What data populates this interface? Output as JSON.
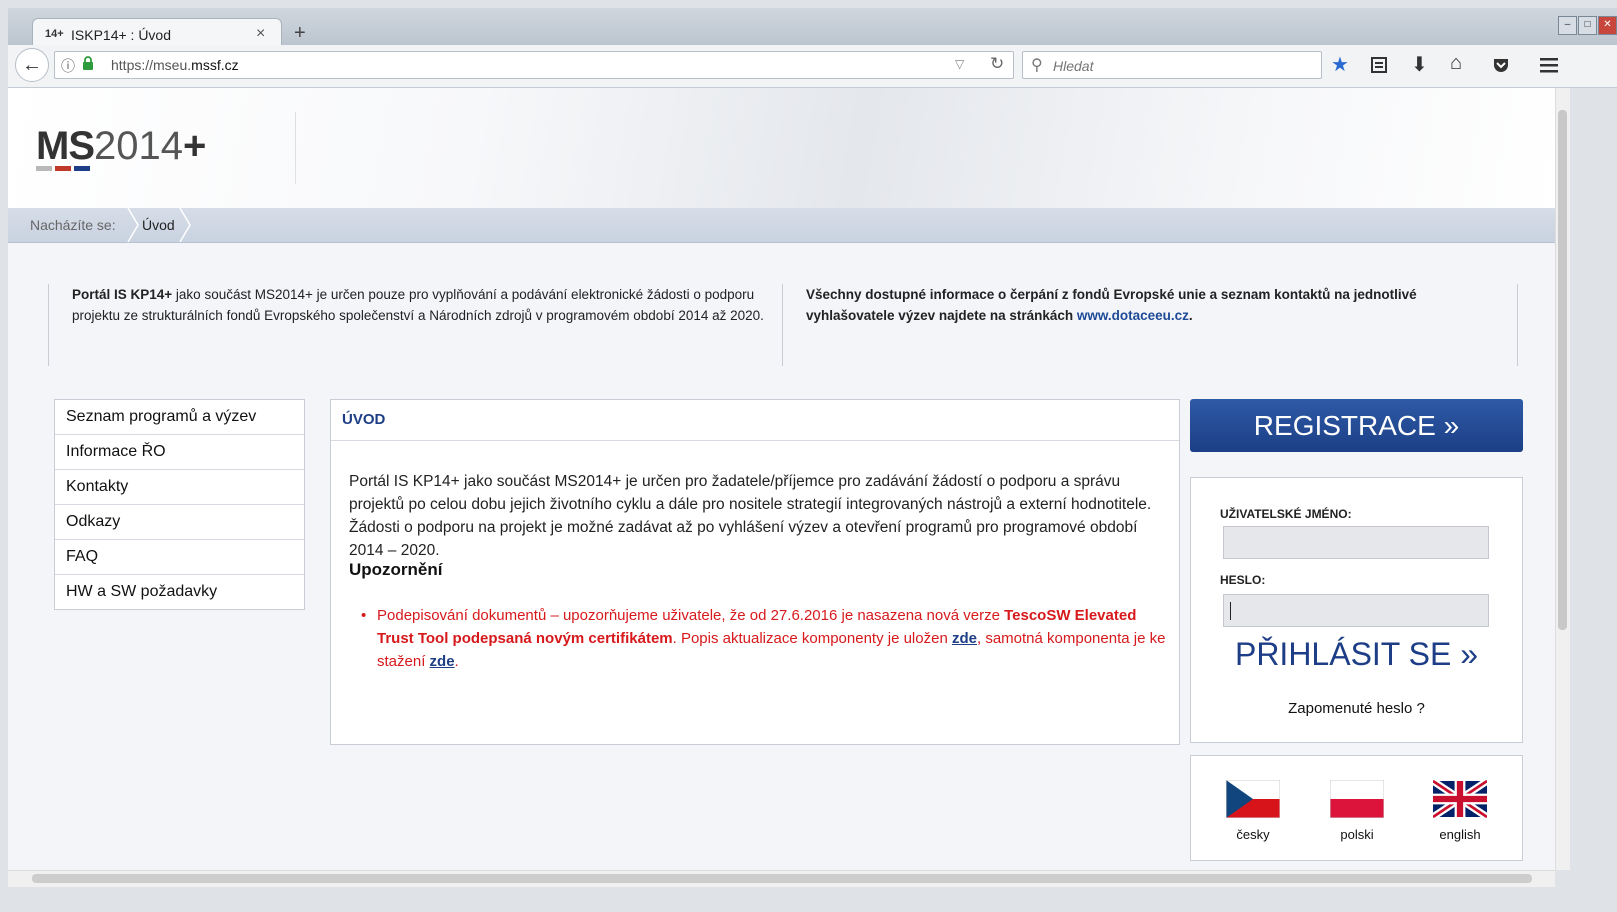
{
  "browser": {
    "tab_icon_text": "14+",
    "tab_title": "ISKP14+ : Úvod",
    "tab_close": "×",
    "new_tab": "+",
    "window_controls": [
      "–",
      "□",
      "✕"
    ],
    "url_prefix": "https://mseu.",
    "url_domain": "mssf.cz",
    "search_placeholder": "Hledat",
    "toolbar_icons": [
      "star-icon",
      "reading-list-icon",
      "download-icon",
      "home-icon",
      "pocket-icon",
      "menu-icon"
    ]
  },
  "header": {
    "logo_ms": "MS",
    "logo_year": "2014",
    "logo_plus": "+",
    "logo_colors": [
      "#b9b9b9",
      "#c0392b",
      "#1d3e86"
    ]
  },
  "breadcrumb": {
    "label": "Nacházíte se:",
    "current": "Úvod"
  },
  "intro": {
    "left_bold": "Portál IS KP14+",
    "left_text": " jako součást MS2014+ je určen pouze pro vyplňování a podávání elektronické žádosti o podporu projektu ze strukturálních fondů Evropského společenství a Národních zdrojů v programovém období 2014 až 2020.",
    "right_text": "Všechny dostupné informace o čerpání z fondů Evropské unie a seznam kontaktů na jednotlivé vyhlašovatele výzev najdete na stránkách ",
    "right_link": "www.dotaceeu.cz",
    "right_end": "."
  },
  "menu": {
    "items": [
      {
        "label": "Seznam programů a výzev"
      },
      {
        "label": "Informace ŘO"
      },
      {
        "label": "Kontakty"
      },
      {
        "label": "Odkazy"
      },
      {
        "label": "FAQ"
      },
      {
        "label": "HW a SW požadavky"
      }
    ]
  },
  "content": {
    "title": "ÚVOD",
    "body": "Portál IS KP14+ jako součást MS2014+ je určen pro žadatele/příjemce pro zadávání žádostí o podporu a správu projektů po celou dobu jejich životního cyklu a dále pro nositele strategií integrovaných nástrojů a externí hodnotitele. Žádosti o podporu na projekt je možné zadávat až po vyhlášení výzev a otevření programů pro programové období 2014 – 2020.",
    "warning_title": "Upozornění",
    "warning_pre": "Podepisování dokumentů – upozorňujeme uživatele, že od 27.6.2016 je nasazena nová verze ",
    "warning_bold": "TescoSW Elevated Trust Tool podepsaná novým certifikátem",
    "warning_mid": ". Popis aktualizace komponenty je uložen ",
    "warning_link1": "zde",
    "warning_mid2": ", samotná komponenta je ke stažení ",
    "warning_link2": "zde",
    "warning_end": "."
  },
  "login": {
    "register": "REGISTRACE »",
    "username_label": "UŽIVATELSKÉ JMÉNO:",
    "password_label": "HESLO:",
    "login_button": "PŘIHLÁSIT SE »",
    "forgot": "Zapomenuté heslo ?"
  },
  "languages": [
    {
      "label": "česky"
    },
    {
      "label": "polski"
    },
    {
      "label": "english"
    }
  ]
}
